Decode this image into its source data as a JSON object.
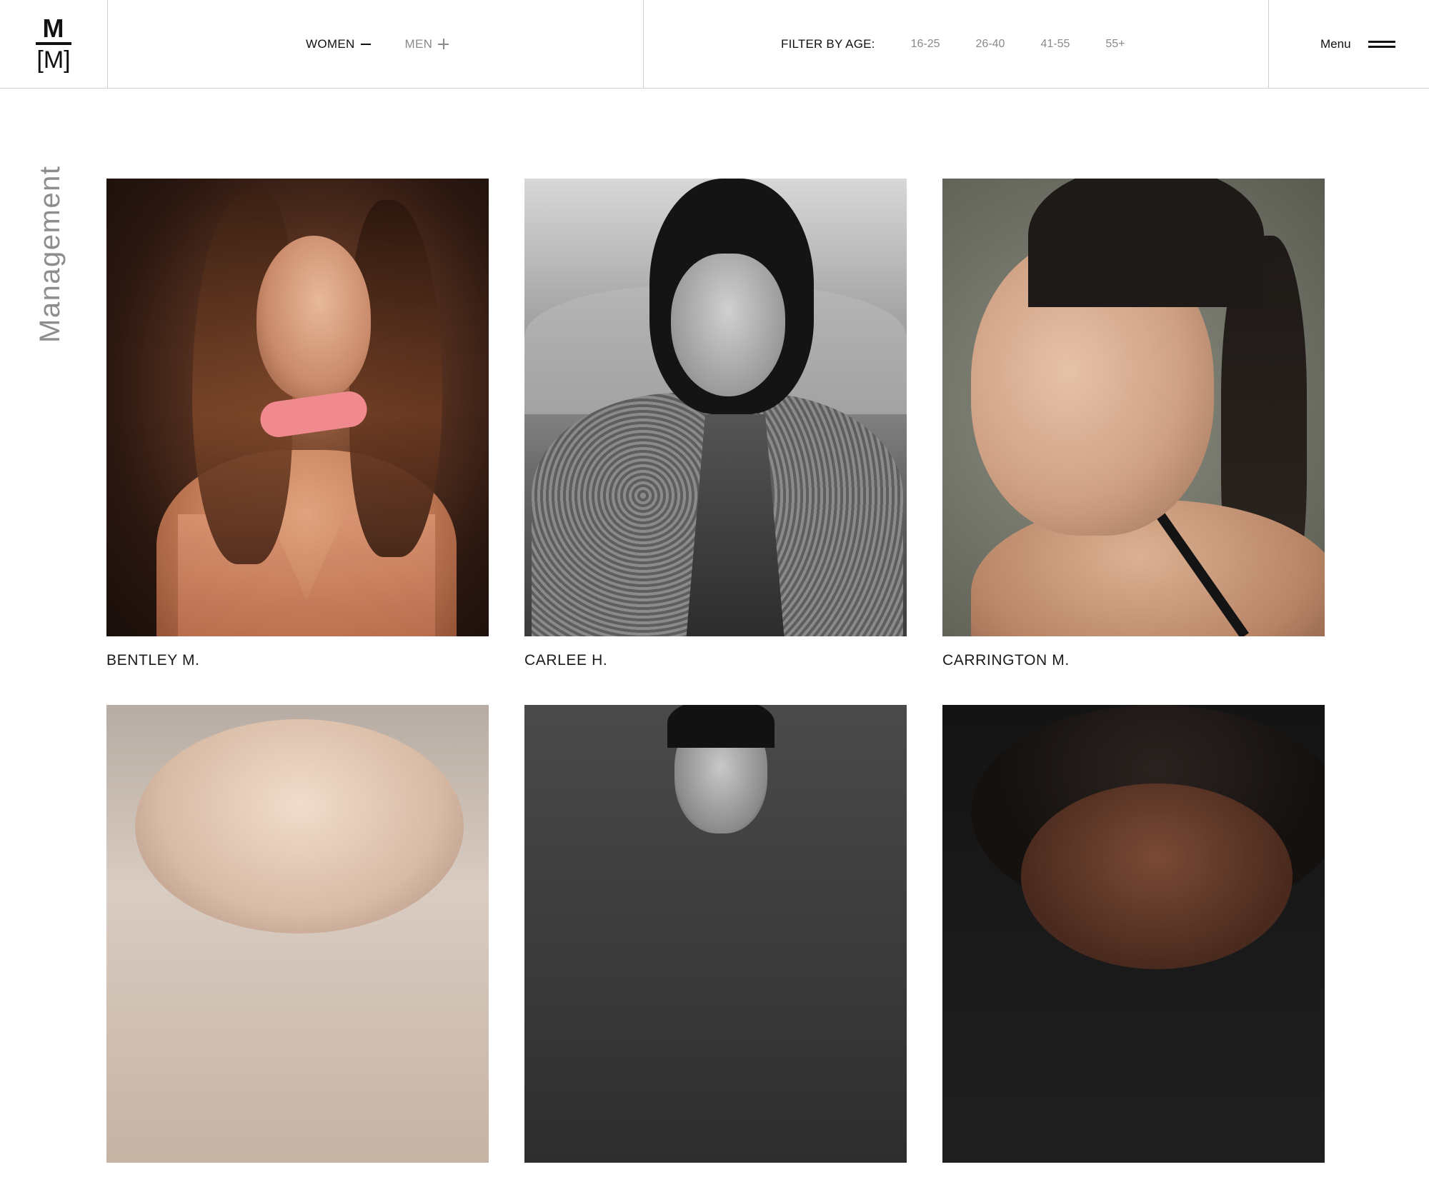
{
  "logo": {
    "top": "M",
    "bottom": "[M]"
  },
  "nav": {
    "women_label": "WOMEN",
    "men_label": "MEN"
  },
  "filter": {
    "label": "FILTER BY AGE:",
    "options": [
      "16-25",
      "26-40",
      "41-55",
      "55+"
    ]
  },
  "menu": {
    "label": "Menu"
  },
  "side_label": "Management",
  "models": [
    {
      "name": "BENTLEY M."
    },
    {
      "name": "CARLEE H."
    },
    {
      "name": "CARRINGTON M."
    },
    {
      "name": ""
    },
    {
      "name": ""
    },
    {
      "name": ""
    }
  ],
  "colors": {
    "text": "#1a1a1a",
    "muted": "#8a8a8a",
    "divider": "#cfcfcf",
    "background": "#ffffff"
  },
  "icons": {
    "women_toggle": "minus-icon",
    "men_toggle": "plus-icon",
    "menu": "hamburger-icon"
  }
}
